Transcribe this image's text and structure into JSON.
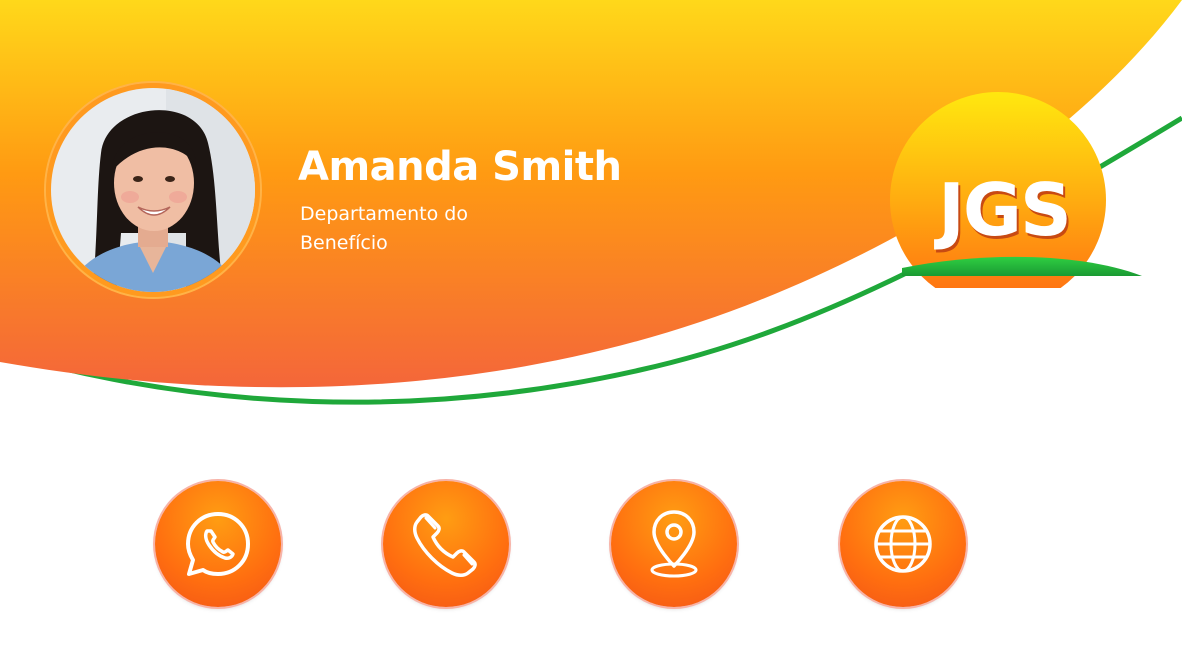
{
  "profile": {
    "name": "Amanda Smith",
    "department_line1": "Departamento do",
    "department_line2": "Benefício"
  },
  "logo": {
    "text": "JGS"
  },
  "contacts": [
    {
      "id": "whatsapp",
      "icon": "whatsapp-icon"
    },
    {
      "id": "phone",
      "icon": "phone-icon"
    },
    {
      "id": "location",
      "icon": "location-pin-icon"
    },
    {
      "id": "website",
      "icon": "globe-icon"
    }
  ],
  "colors": {
    "banner_top": "#ffd51a",
    "banner_mid": "#ff9414",
    "banner_bottom": "#f46d34",
    "accent_green": "#1fa83a",
    "button_orange": "#ff7a10",
    "text_white": "#ffffff"
  }
}
